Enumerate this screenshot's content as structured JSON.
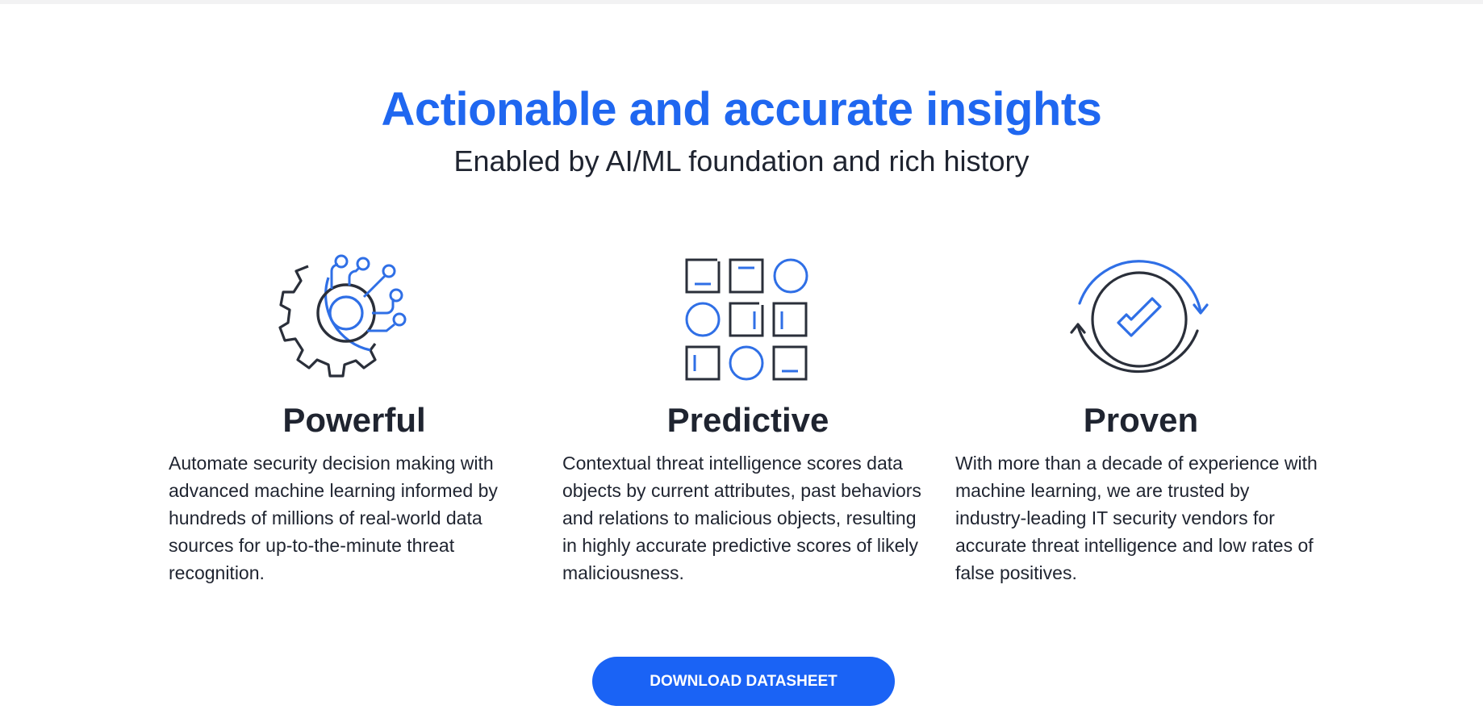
{
  "hero": {
    "title": "Actionable and accurate insights",
    "subtitle": "Enabled by AI/ML foundation and rich history"
  },
  "features": [
    {
      "icon": "gear-circuit-icon",
      "title": "Powerful",
      "description": "Automate security decision making with advanced machine learning informed by hundreds of millions of real-world data sources for up-to-the-minute threat recognition."
    },
    {
      "icon": "grid-pattern-icon",
      "title": "Predictive",
      "description": "Contextual threat intelligence scores data objects by current attributes, past behaviors and relations to malicious objects, resulting in highly accurate predictive scores of likely maliciousness."
    },
    {
      "icon": "verified-check-cycle-icon",
      "title": "Proven",
      "description": "With more than a decade of experience with machine learning, we are trusted by industry-leading IT security vendors for accurate threat intelligence and low rates of false positives."
    }
  ],
  "cta": {
    "label": "DOWNLOAD DATASHEET"
  },
  "colors": {
    "accent": "#1f67f0",
    "button": "#1a63f5",
    "text": "#1f2430",
    "icon_dark": "#2a2f3a",
    "icon_blue": "#2f6fe6"
  }
}
